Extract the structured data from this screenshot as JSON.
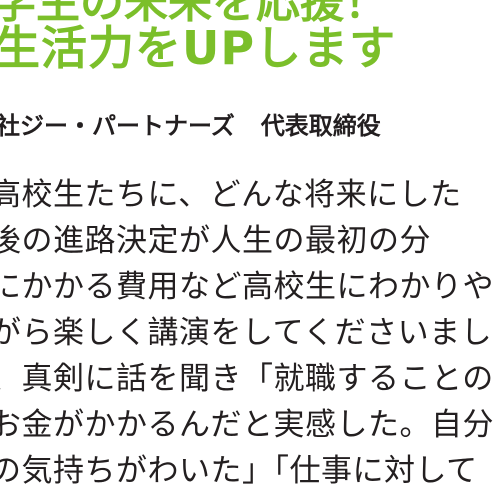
{
  "article": {
    "headline_top": "学生の未来を応援！",
    "headline_main": "生活力をUPします",
    "byline_company": "社ジー・パートナーズ",
    "byline_title": "代表取締役",
    "body_lines": [
      "高校生たちに、どんな将来にした",
      "後の進路決定が人生の最初の分",
      "にかかる費用など高校生にわかりや",
      "がら楽しく講演をしてくださいまし",
      "、真剣に話を聞き「就職することの",
      "お金がかかるんだと実感した。自分",
      "の気持ちがわいた」「仕事に対して"
    ]
  },
  "colors": {
    "headline": "#7bbf2a",
    "text": "#231f20",
    "background": "#ffffff"
  }
}
